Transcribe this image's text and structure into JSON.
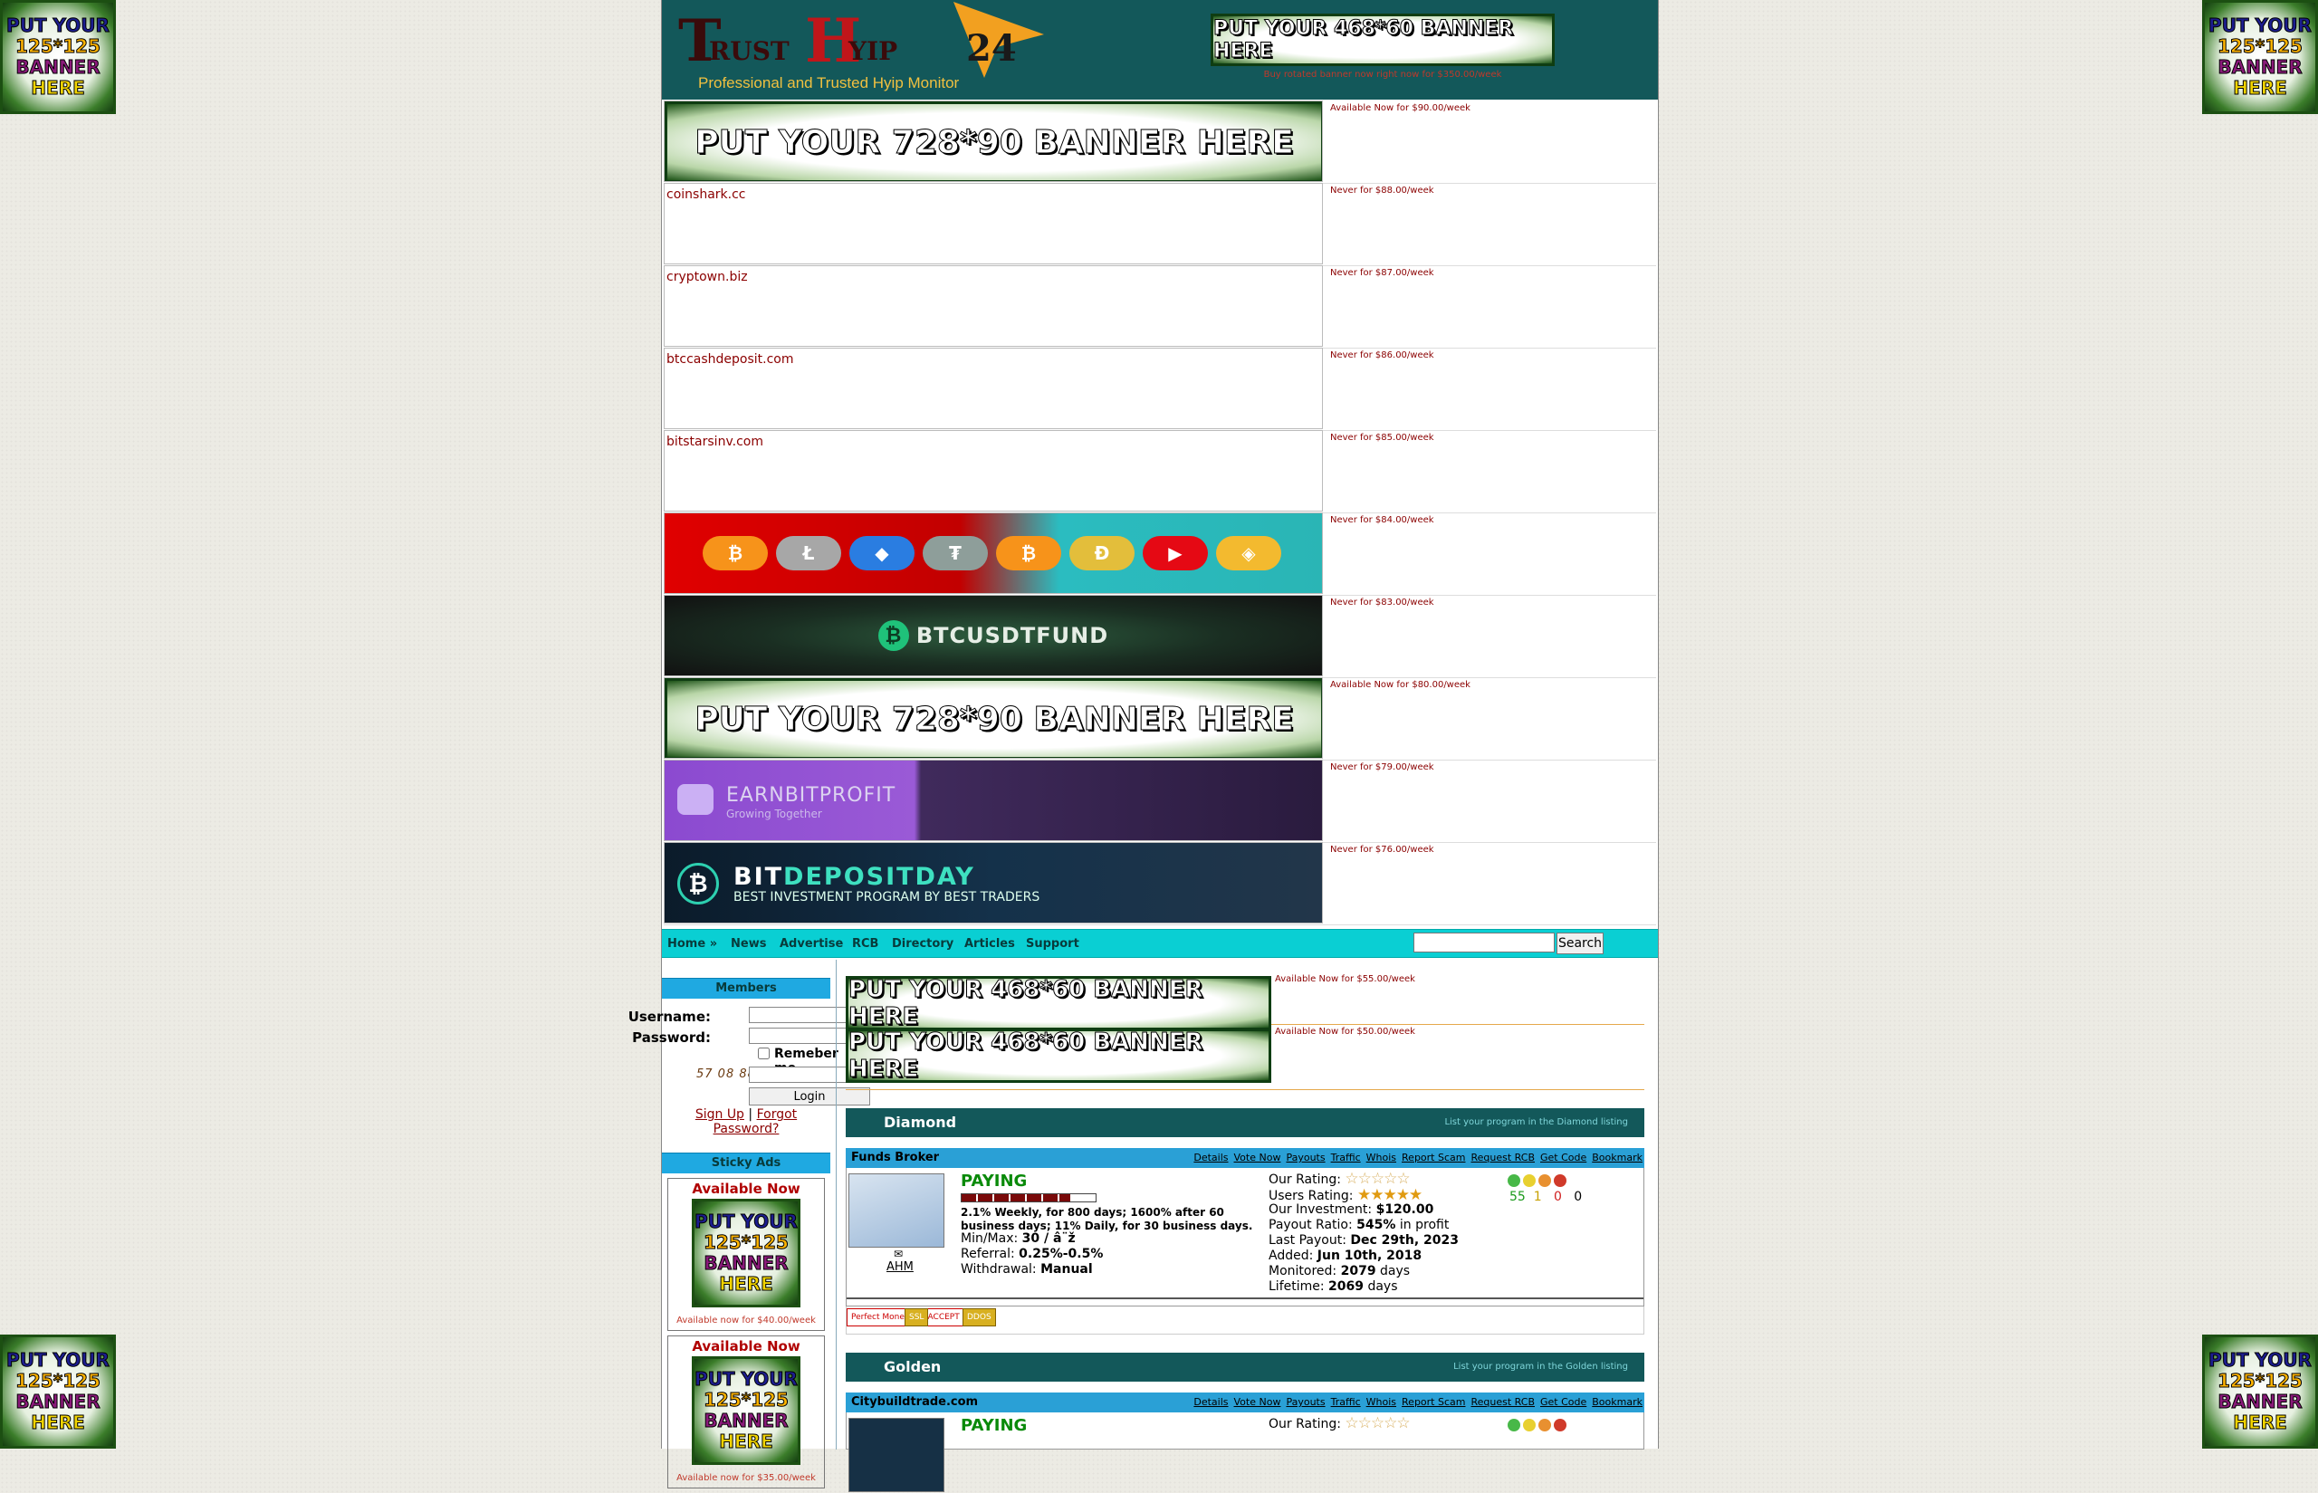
{
  "side_ads": {
    "l1": "PUT YOUR",
    "l2": "125*125",
    "l3": "BANNER",
    "l4": "HERE"
  },
  "header": {
    "logo_t": "T",
    "logo_rust": "RUST",
    "logo_h": "H",
    "logo_yip": "YIP",
    "logo_24": "24",
    "tagline": "Professional and Trusted Hyip Monitor",
    "banner": "PUT YOUR 468*60 BANNER HERE",
    "banner_link": "Buy rotated banner now right now for $350.00/week"
  },
  "top_banners": [
    {
      "kind": "placeholder",
      "text": "PUT YOUR 728*90 BANNER HERE",
      "price": "Available Now for $90.00/week"
    },
    {
      "kind": "broken",
      "text": "coinshark.cc",
      "price": "Never for $88.00/week"
    },
    {
      "kind": "broken",
      "text": "cryptown.biz",
      "price": "Never for $87.00/week"
    },
    {
      "kind": "broken",
      "text": "btccashdeposit.com",
      "price": "Never for $86.00/week"
    },
    {
      "kind": "broken",
      "text": "bitstarsinv.com",
      "price": "Never for $85.00/week"
    },
    {
      "kind": "crypto",
      "text": "",
      "price": "Never for $84.00/week"
    },
    {
      "kind": "btcusdt",
      "text": "BTCUSDTFUND",
      "price": "Never for $83.00/week"
    },
    {
      "kind": "placeholder",
      "text": "PUT YOUR 728*90 BANNER HERE",
      "price": "Available Now for $80.00/week"
    },
    {
      "kind": "earnbit",
      "text": "EARNBITPROFIT",
      "sub": "Growing Together",
      "price": "Never for $79.00/week"
    },
    {
      "kind": "bitdep",
      "text": "BIT",
      "text2": "DEPOSITDAY",
      "sub": "BEST INVESTMENT PROGRAM BY BEST TRADERS",
      "price": "Never for $76.00/week"
    }
  ],
  "crypto_coins": [
    {
      "sym": "₿",
      "color": "#f7931a"
    },
    {
      "sym": "Ł",
      "color": "#a7a7a7"
    },
    {
      "sym": "◆",
      "color": "#2a7de1"
    },
    {
      "sym": "₮",
      "color": "#8e9e9a"
    },
    {
      "sym": "₿",
      "color": "#f7931a"
    },
    {
      "sym": "Đ",
      "color": "#e3be3b"
    },
    {
      "sym": "▶",
      "color": "#e50914"
    },
    {
      "sym": "◈",
      "color": "#f3ba2f"
    }
  ],
  "nav": {
    "home": "Home »",
    "news": "News",
    "advertise": "Advertise",
    "rcb": "RCB",
    "directory": "Directory",
    "articles": "Articles",
    "support": "Support",
    "search_button": "Search",
    "search_value": ""
  },
  "sidebar": {
    "members_title": "Members",
    "username_label": "Username:",
    "password_label": "Password:",
    "remember_label": "Remeber me",
    "captcha": "57 08 88",
    "login_button": "Login",
    "signup": "Sign Up",
    "separator": "|",
    "forgot": "Forgot Password?",
    "sticky_title": "Sticky Ads",
    "sticky": [
      {
        "avail": "Available Now",
        "price": "Available now for $40.00/week"
      },
      {
        "avail": "Available Now",
        "price": "Available now for $35.00/week"
      }
    ]
  },
  "main": {
    "ads468": [
      {
        "text": "PUT YOUR 468*60 BANNER HERE",
        "price": "Available Now for $55.00/week"
      },
      {
        "text": "PUT YOUR 468*60 BANNER HERE",
        "price": "Available Now for $50.00/week"
      }
    ],
    "diamond": {
      "title": "Diamond",
      "link": "List your program in the Diamond listing"
    },
    "golden": {
      "title": "Golden",
      "link": "List your program in the Golden listing"
    },
    "prog_links": [
      "Details",
      "Vote Now",
      "Payouts",
      "Traffic",
      "Whois",
      "Report Scam",
      "Request RCB",
      "Get Code",
      "Bookmark"
    ],
    "program1": {
      "name": "Funds Broker",
      "status": "PAYING",
      "plan": "2.1% Weekly, for 800 days; 1600% after 60 business days; 11% Daily, for 30 business days.",
      "minmax_label": "Min/Max:",
      "minmax": "30 / â¨ž",
      "referral_label": "Referral:",
      "referral": "0.25%-0.5%",
      "withdrawal_label": "Withdrawal:",
      "withdrawal": "Manual",
      "ahm": "AHM",
      "our_rating_label": "Our Rating:",
      "users_rating_label": "Users Rating:",
      "our_investment_label": "Our Investment:",
      "our_investment": "$120.00",
      "payout_ratio_label": "Payout Ratio:",
      "payout_ratio": "545%",
      "payout_ratio_suffix": "in profit",
      "last_payout_label": "Last Payout:",
      "last_payout": "Dec 29th, 2023",
      "added_label": "Added:",
      "added": "Jun 10th, 2018",
      "monitored_label": "Monitored:",
      "monitored": "2079",
      "monitored_suffix": "days",
      "lifetime_label": "Lifetime:",
      "lifetime": "2069",
      "lifetime_suffix": "days",
      "votes": [
        "55",
        "1",
        "0",
        "0"
      ],
      "badges": [
        "Perfect Money WE ACCEPT",
        "SSL",
        "DDOS"
      ]
    },
    "program2": {
      "name": "Citybuildtrade.com",
      "status": "PAYING",
      "our_rating_label": "Our Rating:"
    }
  }
}
